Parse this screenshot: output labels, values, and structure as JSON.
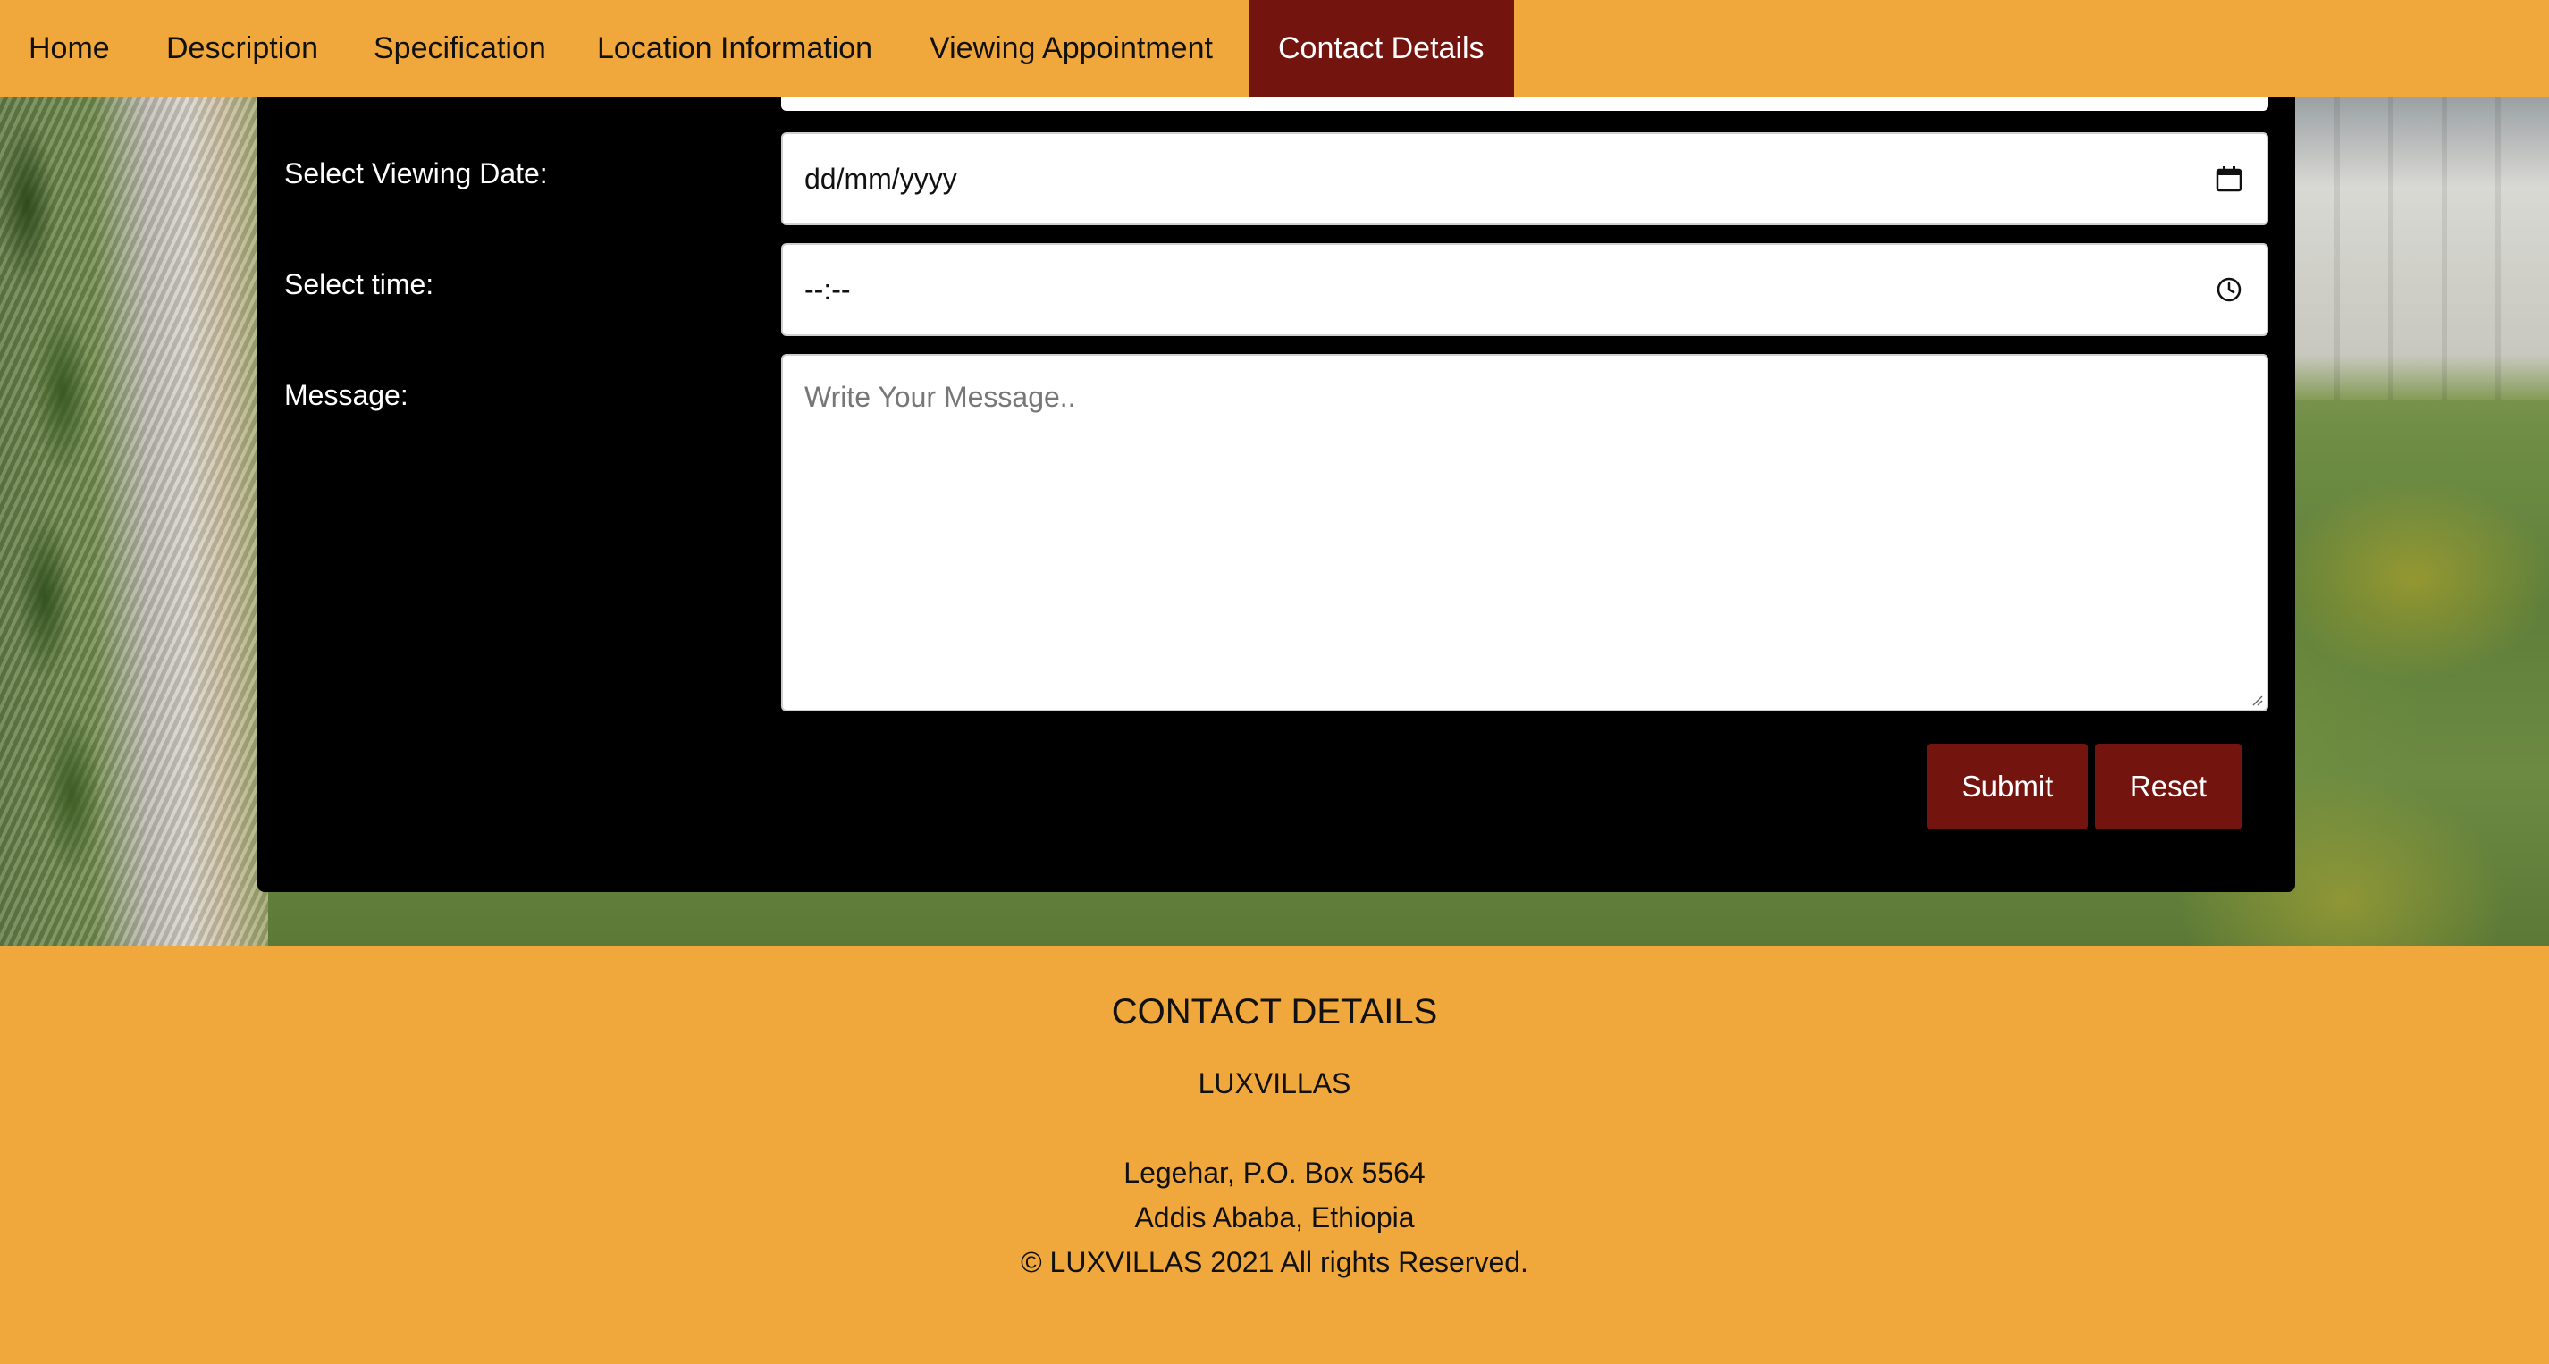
{
  "nav": {
    "items": [
      {
        "label": "Home"
      },
      {
        "label": "Description"
      },
      {
        "label": "Specification"
      },
      {
        "label": "Location Information"
      },
      {
        "label": "Viewing Appointment"
      },
      {
        "label": "Contact Details"
      }
    ],
    "active_index": 5
  },
  "form": {
    "viewing_date": {
      "label": "Select Viewing Date:",
      "value": "dd/mm/yyyy",
      "icon": "calendar-icon"
    },
    "time": {
      "label": "Select time:",
      "value": "--:--",
      "icon": "clock-icon"
    },
    "message": {
      "label": "Message:",
      "placeholder": "Write Your Message.."
    },
    "submit_label": "Submit",
    "reset_label": "Reset"
  },
  "footer": {
    "title": "CONTACT DETAILS",
    "company": "LUXVILLAS",
    "address_line1": "Legehar, P.O. Box 5564",
    "address_line2": "Addis Ababa, Ethiopia",
    "copyright": "© LUXVILLAS 2021 All rights Reserved."
  },
  "colors": {
    "nav_bg": "#f0a73b",
    "accent": "#74140f",
    "panel_bg": "#000000",
    "footer_bg": "#f0a73b"
  }
}
